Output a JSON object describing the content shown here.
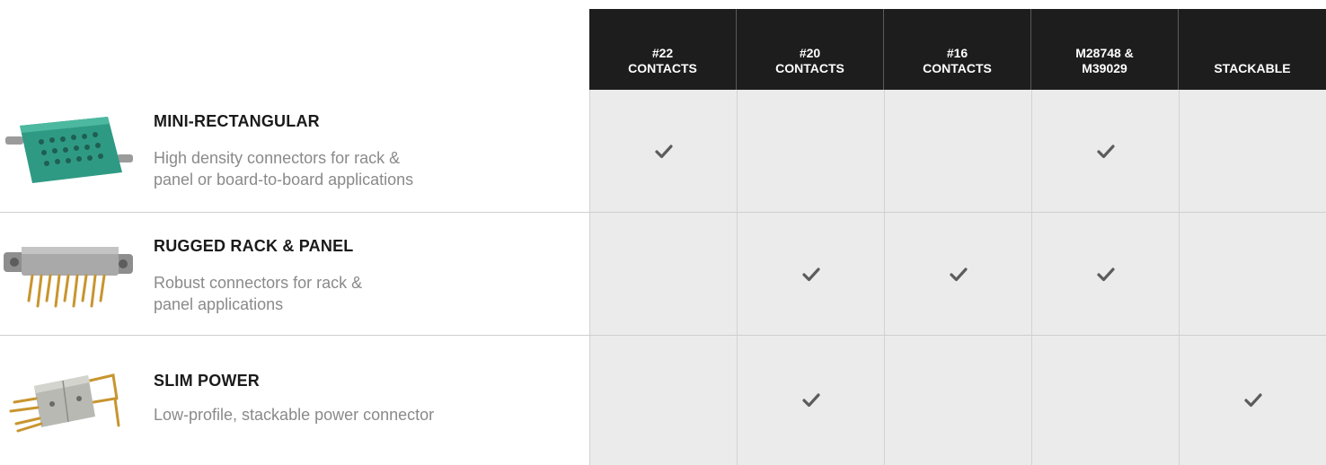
{
  "columns": [
    {
      "line1": "#22",
      "line2": "CONTACTS"
    },
    {
      "line1": "#20",
      "line2": "CONTACTS"
    },
    {
      "line1": "#16",
      "line2": "CONTACTS"
    },
    {
      "line1": "M28748 &",
      "line2": "M39029"
    },
    {
      "line1": "",
      "line2": "STACKABLE"
    }
  ],
  "rows": [
    {
      "title": "MINI-RECTANGULAR",
      "desc_line1": "High density connectors for rack &",
      "desc_line2": "panel or board-to-board applications",
      "checks": [
        true,
        false,
        false,
        true,
        false
      ],
      "image_icon": "mini-rectangular-connector-icon",
      "image_color": "#2f9a84"
    },
    {
      "title": "RUGGED RACK & PANEL",
      "desc_line1": "Robust connectors for rack &",
      "desc_line2": "panel applications",
      "checks": [
        false,
        true,
        true,
        true,
        false
      ],
      "image_icon": "rugged-rack-panel-connector-icon",
      "image_color": "#9a9a9a"
    },
    {
      "title": "SLIM POWER",
      "desc_line1": "Low-profile, stackable power connector",
      "desc_line2": "",
      "checks": [
        false,
        true,
        false,
        false,
        true
      ],
      "image_icon": "slim-power-connector-icon",
      "image_color": "#b5b5b0"
    }
  ],
  "colors": {
    "header_bg": "#1d1d1d",
    "cell_bg": "#ebebeb",
    "check": "#5c5c5c",
    "title": "#1a1a1a",
    "desc": "#8a8a8a"
  }
}
